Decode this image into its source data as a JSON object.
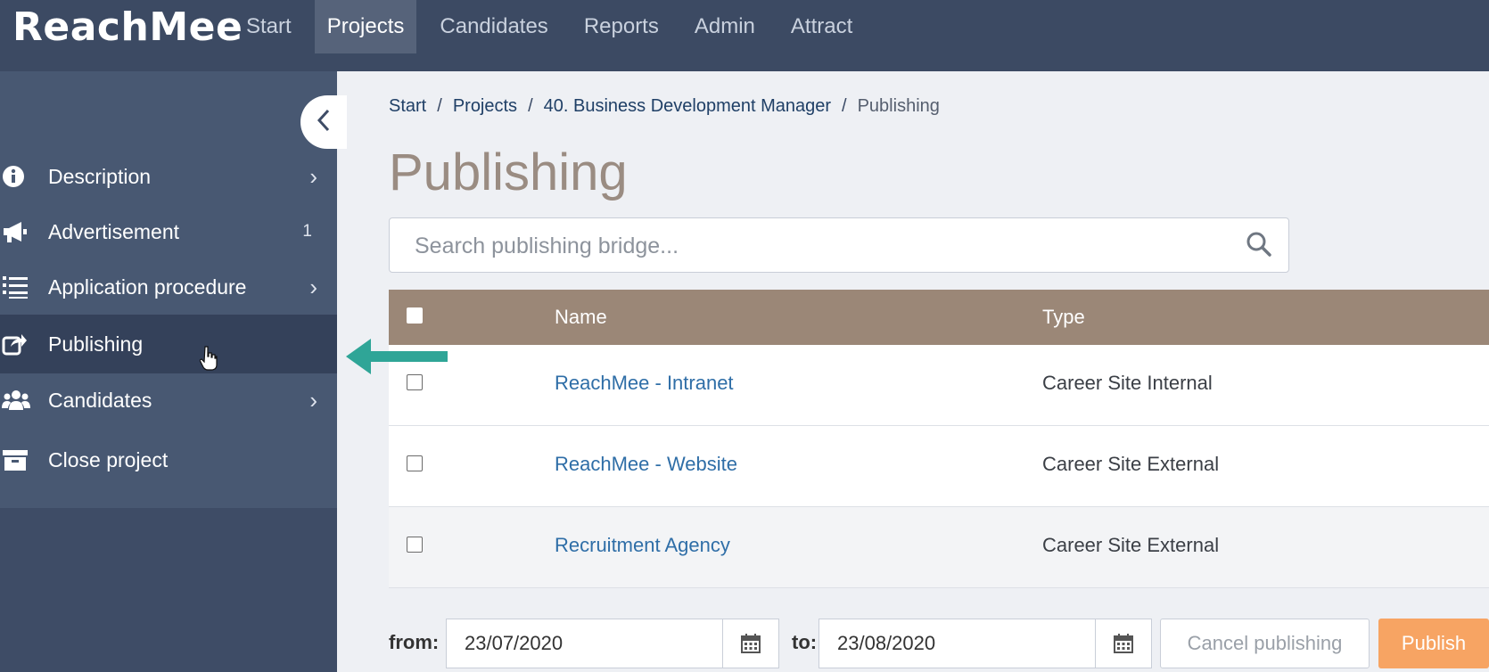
{
  "app": {
    "brand": "ReachMee"
  },
  "topnav": {
    "items": [
      {
        "label": "Start"
      },
      {
        "label": "Projects",
        "active": true
      },
      {
        "label": "Candidates"
      },
      {
        "label": "Reports"
      },
      {
        "label": "Admin"
      },
      {
        "label": "Attract"
      }
    ]
  },
  "sidebar": {
    "collapse_icon": "chevron-left-icon",
    "items": [
      {
        "label": "Description",
        "icon": "info-icon",
        "chevron": "›"
      },
      {
        "label": "Advertisement",
        "icon": "megaphone-icon",
        "badge": "1"
      },
      {
        "label": "Application procedure",
        "icon": "numbered-list-icon",
        "chevron": "›"
      },
      {
        "label": "Publishing",
        "icon": "share-icon",
        "active": true
      },
      {
        "label": "Candidates",
        "icon": "users-icon",
        "chevron": "›"
      },
      {
        "label": "Close project",
        "icon": "archive-icon"
      }
    ]
  },
  "breadcrumb": {
    "items": [
      "Start",
      "Projects",
      "40. Business Development Manager",
      "Publishing"
    ],
    "separator": "/"
  },
  "page": {
    "title": "Publishing"
  },
  "search": {
    "placeholder": "Search publishing bridge...",
    "value": ""
  },
  "table": {
    "headers": {
      "name": "Name",
      "type": "Type"
    },
    "rows": [
      {
        "name": "ReachMee - Intranet",
        "type": "Career Site Internal"
      },
      {
        "name": "ReachMee - Website",
        "type": "Career Site External"
      },
      {
        "name": "Recruitment Agency",
        "type": "Career Site External"
      }
    ]
  },
  "dates": {
    "from_label": "from:",
    "from_value": "23/07/2020",
    "to_label": "to:",
    "to_value": "23/08/2020"
  },
  "actions": {
    "cancel_label": "Cancel publishing",
    "publish_label": "Publish"
  },
  "colors": {
    "topbar": "#3c4a63",
    "sidebar": "#485872",
    "table_header": "#9b8777",
    "link": "#2f6ea7",
    "publish": "#f7a463",
    "arrow": "#2fa597"
  }
}
